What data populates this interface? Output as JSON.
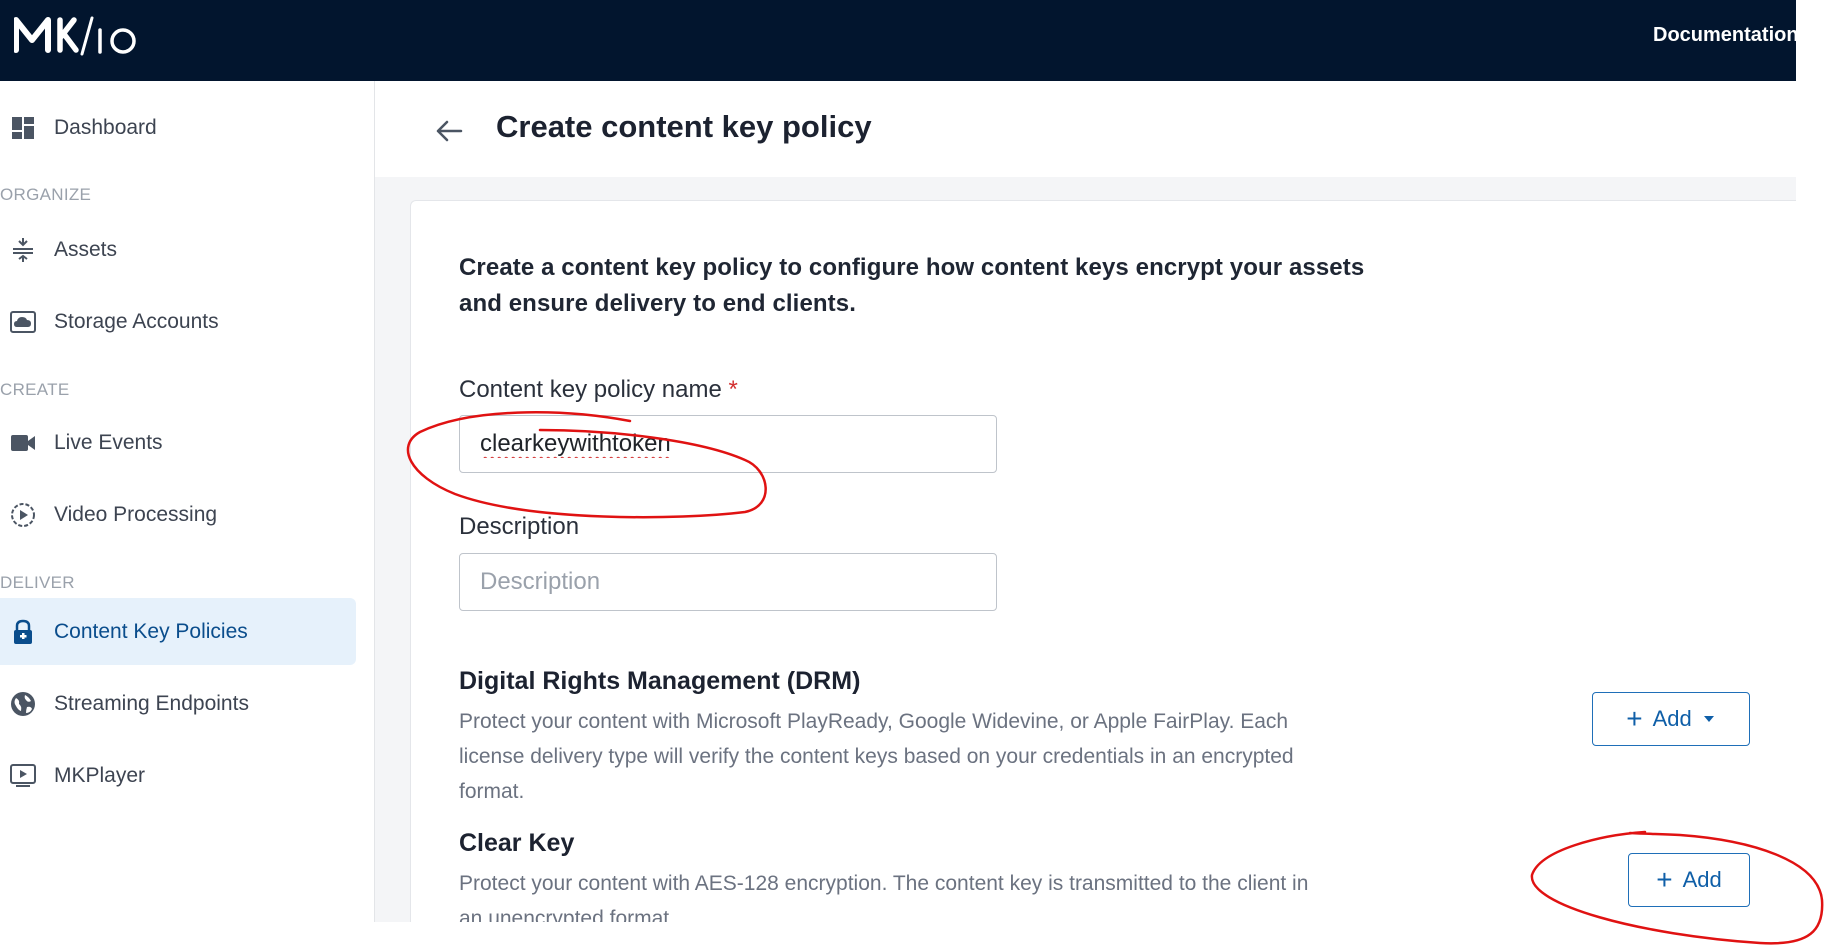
{
  "app": {
    "logo_text": "MK/IO",
    "doc_link": "Documentation"
  },
  "sidebar": {
    "items": [
      {
        "label": "Dashboard",
        "icon": "dashboard-icon"
      },
      {
        "label": "Assets",
        "icon": "assets-icon"
      },
      {
        "label": "Storage Accounts",
        "icon": "cloud-icon"
      },
      {
        "label": "Live Events",
        "icon": "video-camera-icon"
      },
      {
        "label": "Video Processing",
        "icon": "play-circle-icon"
      },
      {
        "label": "Content Key Policies",
        "icon": "lock-icon",
        "active": true
      },
      {
        "label": "Streaming Endpoints",
        "icon": "globe-icon"
      },
      {
        "label": "MKPlayer",
        "icon": "player-icon"
      }
    ],
    "sections": {
      "organize": "ORGANIZE",
      "create": "CREATE",
      "deliver": "DELIVER"
    }
  },
  "header": {
    "title": "Create content key policy"
  },
  "form": {
    "intro": "Create a content key policy to configure how content keys encrypt your assets and ensure delivery to end clients.",
    "name_label": "Content key policy name",
    "required_mark": "*",
    "name_value": "clearkeywithtoken",
    "description_label": "Description",
    "description_placeholder": "Description",
    "drm": {
      "title": "Digital Rights Management (DRM)",
      "description": "Protect your content with Microsoft PlayReady, Google Widevine, or Apple FairPlay. Each license delivery type will verify the content keys based on your credentials in an encrypted format.",
      "add_label": "Add"
    },
    "clear_key": {
      "title": "Clear Key",
      "description": "Protect your content with AES-128 encryption. The content key is transmitted to the client in an unencrypted format.",
      "add_label": "Add"
    }
  },
  "colors": {
    "topbar": "#02152e",
    "accent": "#0f5fa8",
    "active_bg": "#e6f1fb",
    "annotation": "#e01212"
  }
}
